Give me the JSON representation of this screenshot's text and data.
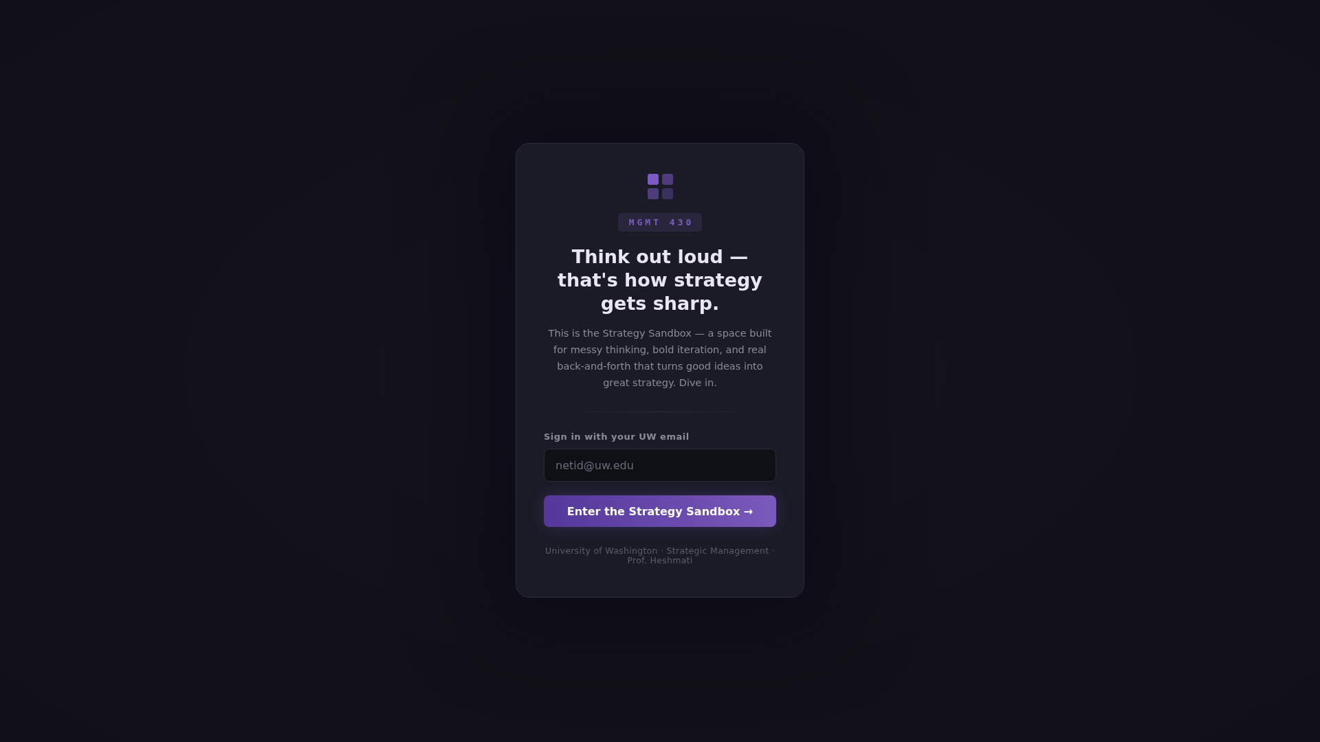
{
  "badge": "MGMT 430",
  "title": "Think out loud — that's how strategy gets sharp.",
  "description": "This is the Strategy Sandbox — a space built for messy thinking, bold iteration, and real back-and-forth that turns good ideas into great strategy. Dive in.",
  "form": {
    "label": "Sign in with your UW email",
    "placeholder": "netid@uw.edu",
    "button": "Enter the Strategy Sandbox →"
  },
  "footer": "University of Washington · Strategic Management · Prof. Heshmati"
}
